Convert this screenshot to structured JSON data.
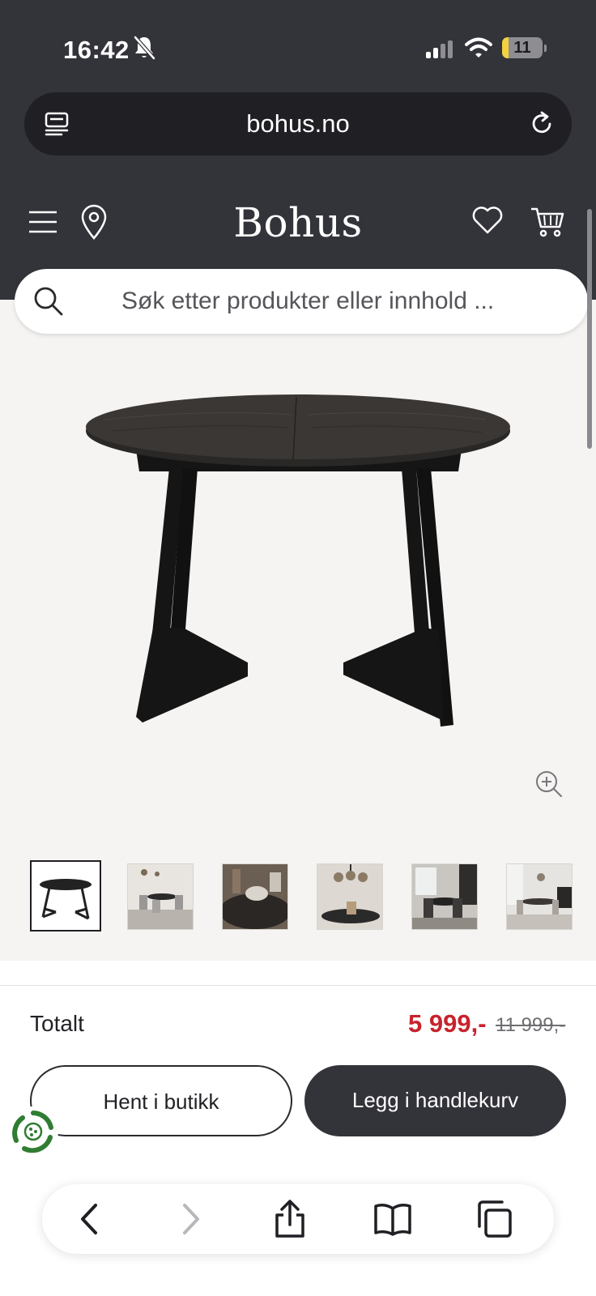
{
  "status_bar": {
    "time": "16:42",
    "battery_percent": "11",
    "icons": [
      "bell-slash-icon",
      "cellular-signal-icon",
      "wifi-icon",
      "battery-icon"
    ]
  },
  "browser": {
    "url": "bohus.no",
    "icons": [
      "tab-overview-icon",
      "reload-icon"
    ]
  },
  "site_header": {
    "logo": "Bohus",
    "icons": [
      "hamburger-menu-icon",
      "location-pin-icon",
      "heart-icon",
      "cart-icon"
    ]
  },
  "search": {
    "placeholder": "Søk etter produkter eller innhold ..."
  },
  "gallery": {
    "thumbnail_count": 6,
    "active_index": 0,
    "zoom_icon": "zoom-in-icon"
  },
  "purchase": {
    "total_label": "Totalt",
    "price": "5 999,-",
    "old_price": "11 999,-",
    "pickup_button": "Hent i butikk",
    "add_to_cart_button": "Legg i handlekurv"
  },
  "browser_toolbar": {
    "icons": [
      "back-icon",
      "forward-icon",
      "share-icon",
      "bookmarks-icon",
      "tabs-icon"
    ]
  },
  "colors": {
    "header_bg": "#33333a",
    "sale_price": "#c8232c",
    "page_bg": "#f5f4f2",
    "eco_green": "#2f7d32"
  }
}
